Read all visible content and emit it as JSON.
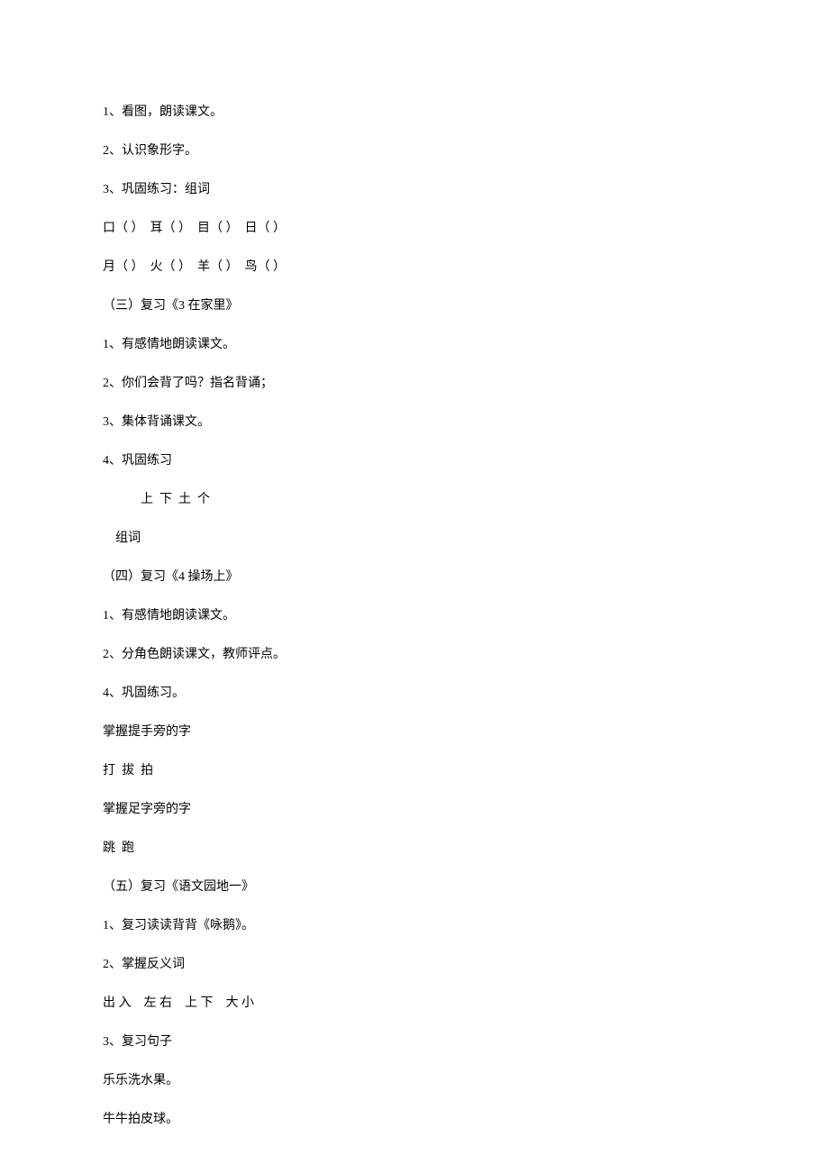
{
  "lines": [
    {
      "text": "1、看图，朗读课文。",
      "indent": ""
    },
    {
      "text": "2、认识象形字。",
      "indent": ""
    },
    {
      "text": "3、巩固练习：组词",
      "indent": ""
    },
    {
      "text": "口（ ）  耳（ ）  目（ ）  日（ ）",
      "indent": ""
    },
    {
      "text": "月（ ）  火（ ）  羊（ ）  鸟（ ）",
      "indent": ""
    },
    {
      "text": "（三）复习《3 在家里》",
      "indent": ""
    },
    {
      "text": "1、有感情地朗读课文。",
      "indent": ""
    },
    {
      "text": "2、你们会背了吗？指名背诵；",
      "indent": ""
    },
    {
      "text": "3、集体背诵课文。",
      "indent": ""
    },
    {
      "text": "4、巩固练习",
      "indent": ""
    },
    {
      "text": "上  下  土  个",
      "indent": "indent-1"
    },
    {
      "text": "组词",
      "indent": "indent-2"
    },
    {
      "text": "（四）复习《4 操场上》",
      "indent": ""
    },
    {
      "text": "1、有感情地朗读课文。",
      "indent": ""
    },
    {
      "text": "2、分角色朗读课文，教师评点。",
      "indent": ""
    },
    {
      "text": "4、巩固练习。",
      "indent": ""
    },
    {
      "text": "掌握提手旁的字",
      "indent": ""
    },
    {
      "text": "打  拔  拍",
      "indent": ""
    },
    {
      "text": "掌握足字旁的字",
      "indent": ""
    },
    {
      "text": "跳  跑",
      "indent": ""
    },
    {
      "text": "（五）复习《语文园地一》",
      "indent": ""
    },
    {
      "text": "1、复习读读背背《咏鹅》。",
      "indent": ""
    },
    {
      "text": "2、掌握反义词",
      "indent": ""
    },
    {
      "text": "出 入    左 右    上 下    大 小",
      "indent": ""
    },
    {
      "text": "3、复习句子",
      "indent": ""
    },
    {
      "text": "乐乐洗水果。",
      "indent": ""
    },
    {
      "text": "牛牛拍皮球。",
      "indent": ""
    }
  ]
}
